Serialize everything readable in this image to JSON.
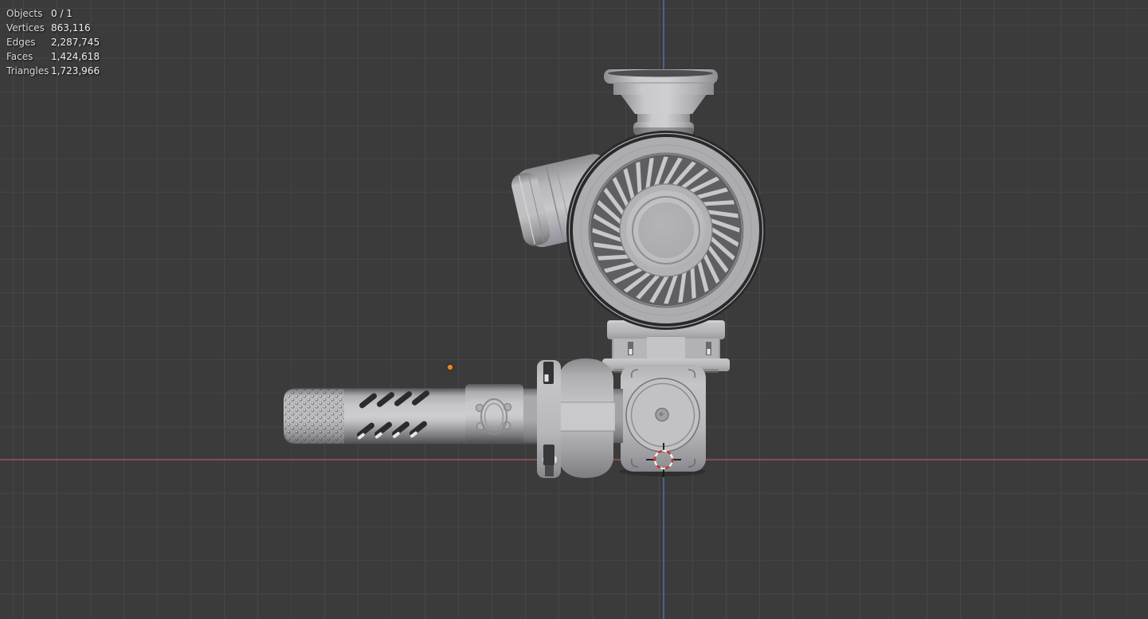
{
  "stats": {
    "rows": [
      {
        "label": "Objects",
        "value": "0 / 1"
      },
      {
        "label": "Vertices",
        "value": "863,116"
      },
      {
        "label": "Edges",
        "value": "2,287,745"
      },
      {
        "label": "Faces",
        "value": "1,424,618"
      },
      {
        "label": "Triangles",
        "value": "1,723,966"
      }
    ]
  },
  "colors": {
    "background": "#3b3b3b",
    "grid_line": "#474749",
    "axis_x_red": "#9d5058",
    "axis_z_blue": "#4d6f99",
    "object_origin_orange": "#df8430",
    "cursor_red": "#c13838",
    "cursor_white": "#f0f0f0",
    "model_gray": "#c4c4c6"
  }
}
